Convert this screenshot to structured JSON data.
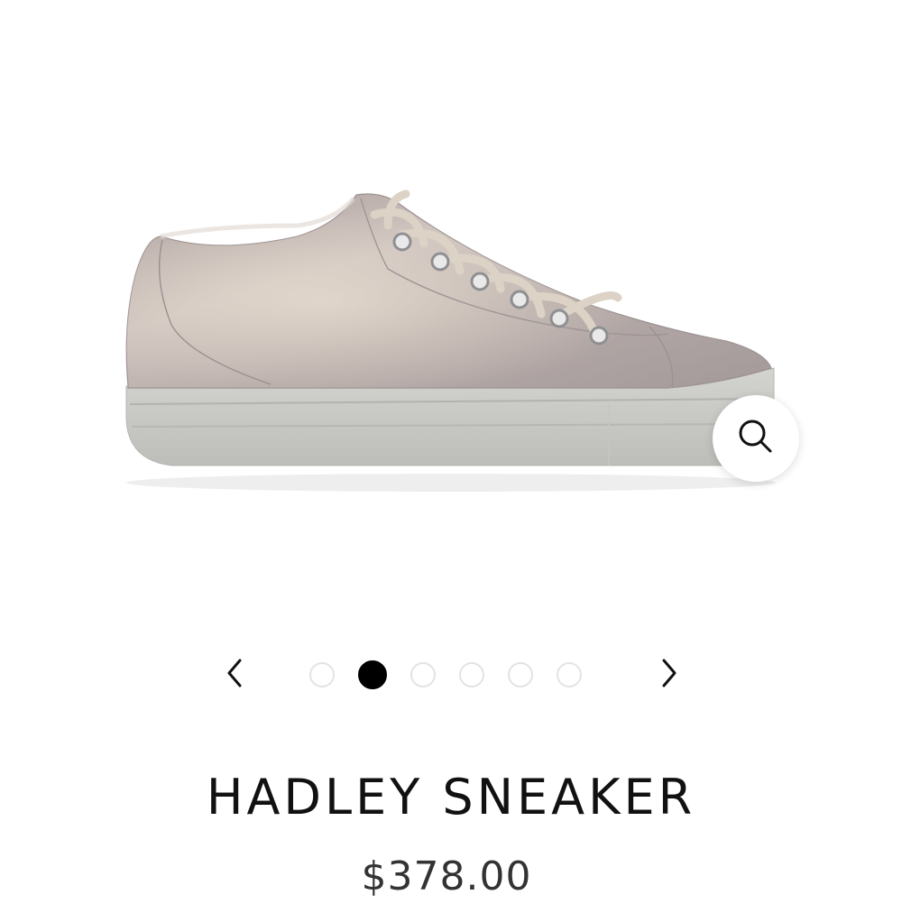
{
  "product": {
    "image": {
      "alt": "Hadley Sneaker metallic taupe leather low-top with elastic laces",
      "colors": {
        "upper": "#b9aeac",
        "sole": "#cfcfcb",
        "lace": "#ddd5c8",
        "eyelet": "#a7a7a9"
      }
    },
    "zoom": {
      "icon": "magnifier-icon"
    },
    "carousel": {
      "prev_icon": "chevron-left-icon",
      "next_icon": "chevron-right-icon",
      "slide_count": 6,
      "active_index": 1
    },
    "title": "HADLEY SNEAKER",
    "price": "$378.00"
  }
}
